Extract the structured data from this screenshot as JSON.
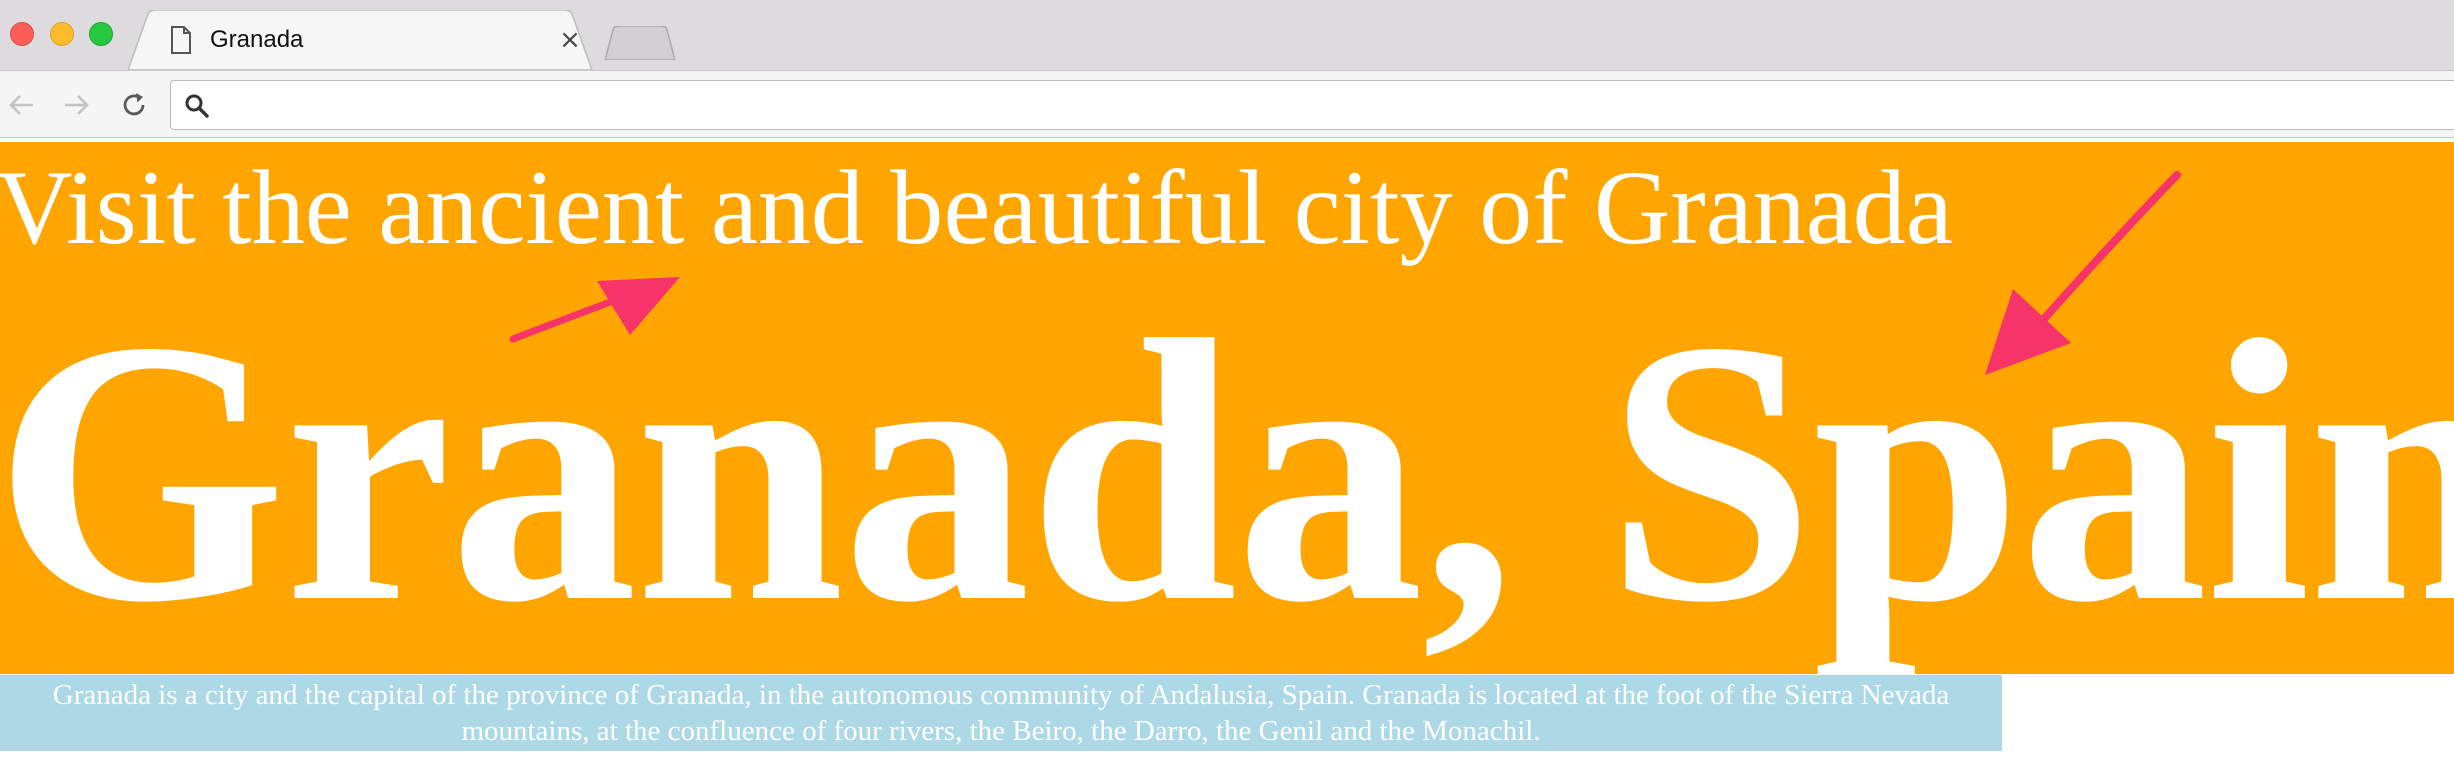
{
  "browser": {
    "tab_title": "Granada",
    "tab_close_glyph": "×",
    "address_value": "",
    "icons": {
      "window_close": "window-close-icon",
      "window_minimize": "window-minimize-icon",
      "window_maximize": "window-maximize-icon",
      "tab_document": "document-icon",
      "back": "back-arrow-icon",
      "forward": "forward-arrow-icon",
      "reload": "reload-icon",
      "search": "search-icon"
    }
  },
  "page": {
    "subtitle": "Visit the ancient and beautiful city of Granada",
    "headline": "Granada, Spain",
    "description": "Granada is a city and the capital of the province of Granada, in the autonomous community of Andalusia, Spain. Granada is located at the foot of the Sierra Nevada mountains, at the confluence of four rivers, the Beiro, the Darro, the Genil and the Monachil."
  },
  "colors": {
    "hero_background": "#ffa500",
    "description_background": "#add8e6",
    "page_text": "#ffffff",
    "annotation_arrow": "#f7346a"
  },
  "annotations": [
    {
      "name": "annotation-arrow-subtitle",
      "icon": "arrow-icon"
    },
    {
      "name": "annotation-arrow-headline",
      "icon": "arrow-icon"
    }
  ]
}
